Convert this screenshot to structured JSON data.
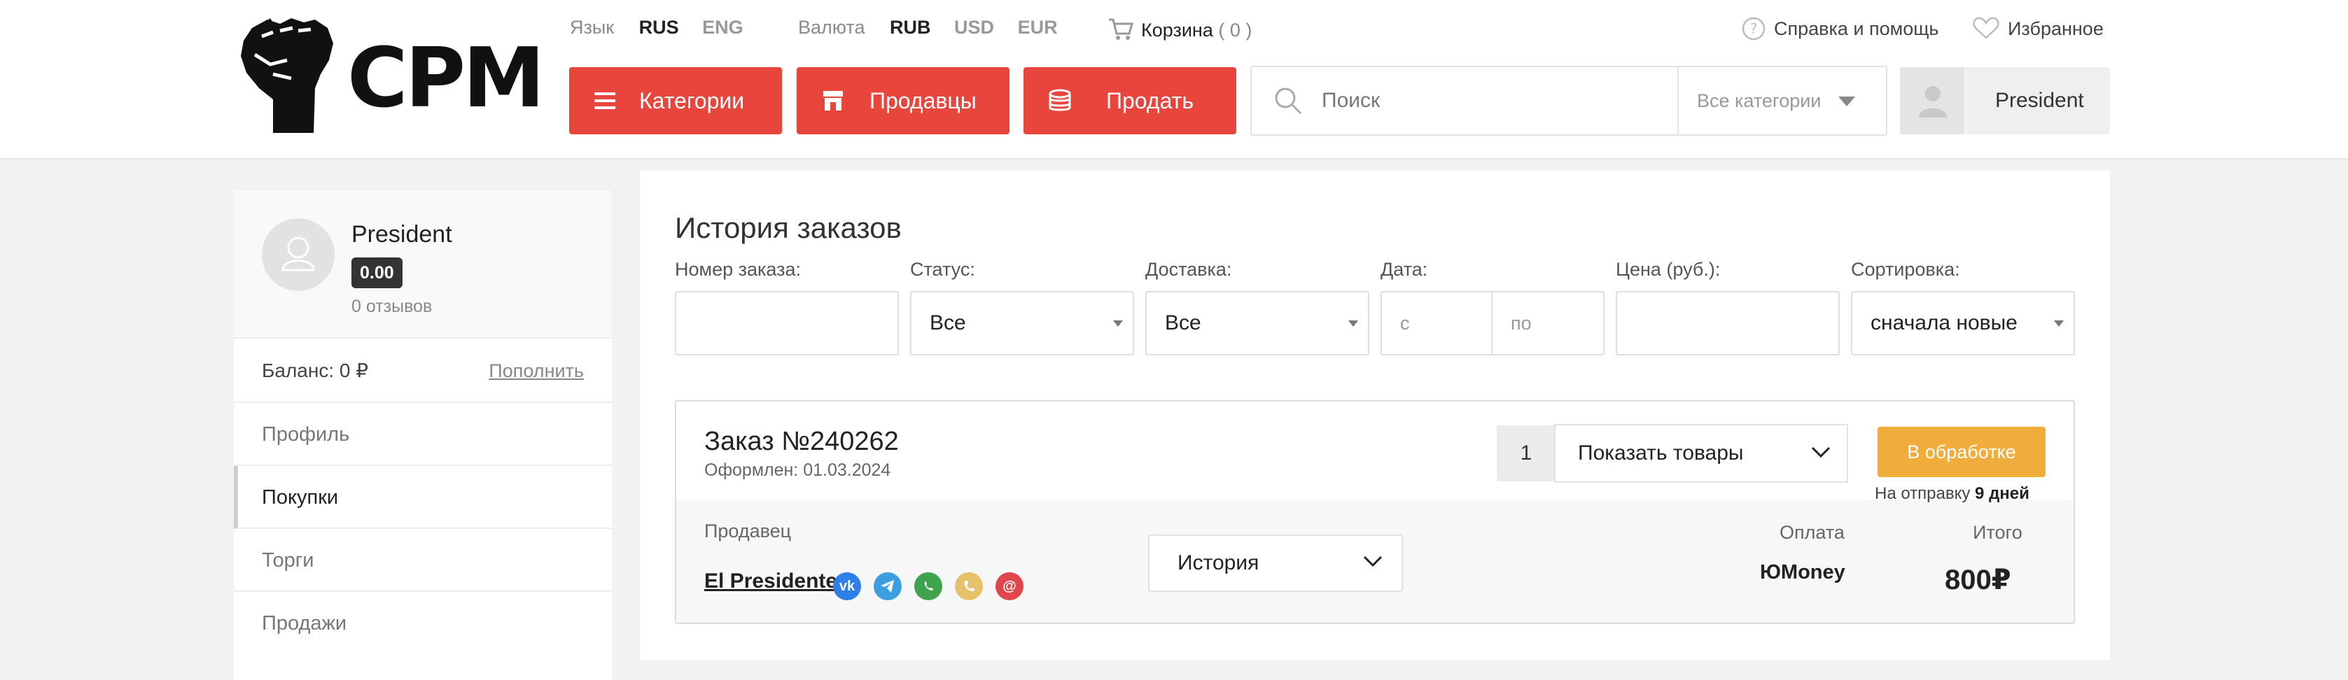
{
  "brand": {
    "name": "CPM"
  },
  "topbar": {
    "lang_label": "Язык",
    "lang_active": "RUS",
    "lang_other": "ENG",
    "cur_label": "Валюта",
    "cur_active": "RUB",
    "cur_usd": "USD",
    "cur_eur": "EUR",
    "cart_label": "Корзина",
    "cart_count": "( 0 )",
    "help": "Справка и помощь",
    "favorites": "Избранное"
  },
  "nav": {
    "categories": "Категории",
    "sellers": "Продавцы",
    "sell": "Продать"
  },
  "search": {
    "placeholder": "Поиск",
    "category": "Все категории"
  },
  "user": {
    "name": "President"
  },
  "sidebar": {
    "name": "President",
    "rating": "0.00",
    "reviews": "0 отзывов",
    "balance": "Баланс: 0 ₽",
    "topup": "Пополнить",
    "items": [
      "Профиль",
      "Покупки",
      "Торги",
      "Продажи"
    ],
    "active_index": 1
  },
  "main": {
    "title": "История заказов",
    "filters": {
      "order_number": "Номер заказа:",
      "status": "Статус:",
      "status_value": "Все",
      "delivery": "Доставка:",
      "delivery_value": "Все",
      "date": "Дата:",
      "date_from": "с",
      "date_to": "по",
      "price": "Цена (руб.):",
      "sort": "Сортировка:",
      "sort_value": "сначала новые"
    },
    "order": {
      "number": "Заказ №240262",
      "date": "Оформлен: 01.03.2024",
      "qty": "1",
      "show_items": "Показать товары",
      "status": "В обработке",
      "ship_prefix": "На отправку",
      "ship_days": "9 дней",
      "seller_label": "Продавец",
      "seller_name": "El Presidente",
      "history": "История",
      "payment_label": "Оплата",
      "payment_value": "ЮMoney",
      "total_label": "Итого",
      "total_value": "800₽"
    }
  },
  "colors": {
    "accent_red": "#e8453c",
    "status_orange": "#f0ad3c"
  },
  "icons": [
    "cart-icon",
    "help-icon",
    "heart-icon",
    "menu-icon",
    "store-icon",
    "coins-icon",
    "search-icon",
    "user-icon",
    "chevron-down-icon",
    "vk-icon",
    "telegram-icon",
    "whatsapp-icon",
    "phone-icon",
    "email-icon"
  ]
}
